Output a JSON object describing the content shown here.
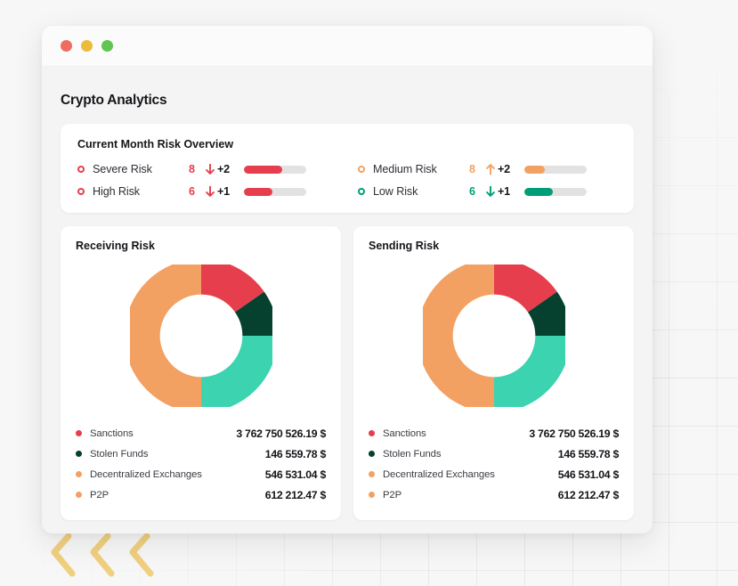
{
  "window": {
    "dots": [
      {
        "name": "close",
        "color": "#ef6c60"
      },
      {
        "name": "minimize",
        "color": "#edba3c"
      },
      {
        "name": "maximize",
        "color": "#61c453"
      }
    ]
  },
  "header": {
    "title": "Crypto Analytics"
  },
  "overview": {
    "title": "Current Month Risk Overview",
    "rows": [
      {
        "label": "Severe Risk",
        "count": "8",
        "arrow": "down",
        "delta": "+2",
        "color": "#e63e4c",
        "fill": 62
      },
      {
        "label": "Medium Risk",
        "count": "8",
        "arrow": "up",
        "delta": "+2",
        "color": "#f3a163",
        "fill": 33
      },
      {
        "label": "High Risk",
        "count": "6",
        "arrow": "down",
        "delta": "+1",
        "color": "#e63e4c",
        "fill": 45
      },
      {
        "label": "Low Risk",
        "count": "6",
        "arrow": "down",
        "delta": "+1",
        "color": "#009e78",
        "fill": 45
      }
    ]
  },
  "chart_data": [
    {
      "type": "pie",
      "title": "Receiving Risk",
      "categories": [
        "Sanctions",
        "Stolen Funds",
        "Decentralized Exchanges",
        "P2P"
      ],
      "values": [
        15.3,
        9.7,
        25.0,
        50.0
      ],
      "labels": [
        "3 762 750 526.19 $",
        "146 559.78 $",
        "546 531.04 $",
        "612 212.47 $"
      ],
      "colors": [
        "#e63e4c",
        "#06402e",
        "#3cd3b0",
        "#f3a163"
      ],
      "legend_position": "bottom",
      "donut": true
    },
    {
      "type": "pie",
      "title": "Sending Risk",
      "categories": [
        "Sanctions",
        "Stolen Funds",
        "Decentralized Exchanges",
        "P2P"
      ],
      "values": [
        15.3,
        9.7,
        25.0,
        50.0
      ],
      "labels": [
        "3 762 750 526.19 $",
        "146 559.78 $",
        "546 531.04 $",
        "612 212.47 $"
      ],
      "colors": [
        "#e63e4c",
        "#06402e",
        "#3cd3b0",
        "#f3a163"
      ],
      "legend_position": "bottom",
      "donut": true
    }
  ],
  "legend_swatch_colors": [
    "#e63e4c",
    "#06402e",
    "#f3a163",
    "#f3a163"
  ]
}
